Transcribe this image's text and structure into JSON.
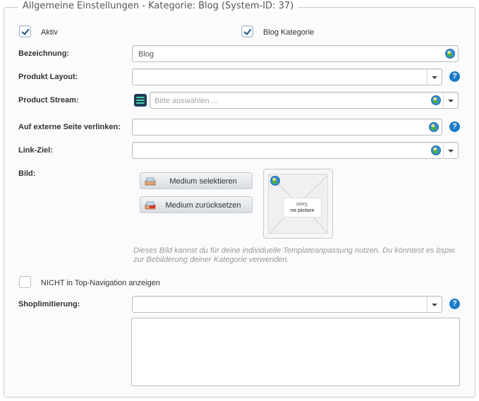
{
  "legend": "Allgemeine Einstellungen - Kategorie: Blog (System-ID: 37)",
  "aktiv": {
    "label": "Aktiv",
    "checked": true
  },
  "blog_kategorie": {
    "label": "Blog Kategorie",
    "checked": true
  },
  "bezeichnung": {
    "label": "Bezeichnung:",
    "value": "Blog"
  },
  "produkt_layout": {
    "label": "Produkt Layout:",
    "value": ""
  },
  "product_stream": {
    "label": "Product Stream:",
    "placeholder": "Bitte auswählen ..."
  },
  "externe_seite": {
    "label": "Auf externe Seite verlinken:",
    "value": ""
  },
  "link_ziel": {
    "label": "Link-Ziel:",
    "value": ""
  },
  "bild": {
    "label": "Bild:",
    "select_button": "Medium selektieren",
    "reset_button": "Medium zurücksetzen",
    "no_picture_line1": "sorry,",
    "no_picture_line2": "no picture",
    "hint": "Dieses Bild kannst du für deine individuelle Templateanpassung nutzen. Du könntest es bspw. zur Bebilderung deiner Kategorie verwenden."
  },
  "top_navigation": {
    "label": "NICHT in Top-Navigation anzeigen",
    "checked": false
  },
  "shoplimitierung": {
    "label": "Shoplimitierung:",
    "value": ""
  },
  "help_glyph": "?",
  "colors": {
    "help_blue": "#1a7bc8",
    "border": "#b5bfc9",
    "check_blue": "#1e4f7f"
  }
}
